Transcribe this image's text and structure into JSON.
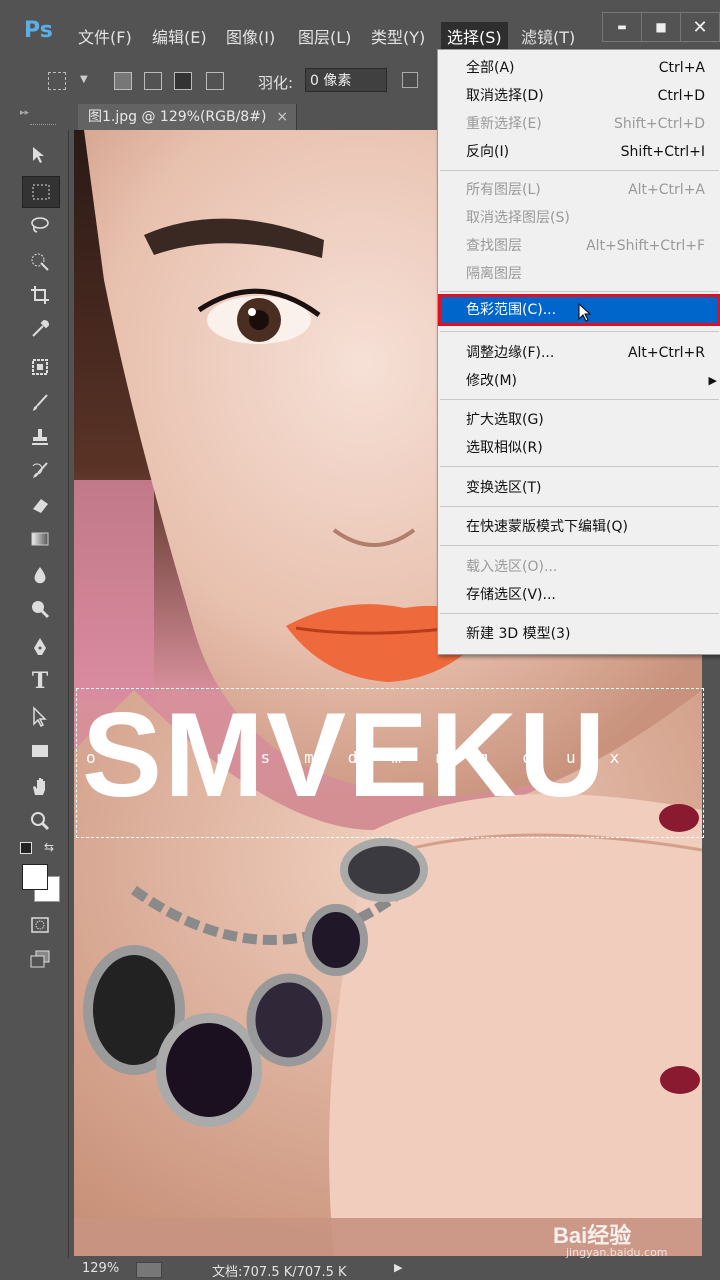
{
  "app": {
    "logo": "Ps"
  },
  "menubar": {
    "items": [
      "文件(F)",
      "编辑(E)",
      "图像(I)",
      "图层(L)",
      "类型(Y)",
      "选择(S)",
      "滤镜(T)"
    ]
  },
  "window_controls": {
    "minimize": "▬",
    "maximize": "■",
    "close": "✕"
  },
  "options": {
    "feather_label": "羽化:",
    "feather_value": "0 像素"
  },
  "document": {
    "tab_title": "图1.jpg @ 129%(RGB/8#)",
    "close": "×"
  },
  "artwork": {
    "brand_text": "SMVEKU",
    "sub_text": "otimsmdmnqoux",
    "watermark": "Bai经验",
    "watermark_url": "jingyan.baidu.com"
  },
  "status": {
    "zoom": "129%",
    "doc_info": "文档:707.5 K/707.5 K"
  },
  "select_menu": {
    "items": [
      {
        "label": "全部(A)",
        "shortcut": "Ctrl+A"
      },
      {
        "label": "取消选择(D)",
        "shortcut": "Ctrl+D"
      },
      {
        "label": "重新选择(E)",
        "shortcut": "Shift+Ctrl+D"
      },
      {
        "label": "反向(I)",
        "shortcut": "Shift+Ctrl+I"
      },
      {
        "label": "所有图层(L)",
        "shortcut": "Alt+Ctrl+A"
      },
      {
        "label": "取消选择图层(S)",
        "shortcut": ""
      },
      {
        "label": "查找图层",
        "shortcut": "Alt+Shift+Ctrl+F"
      },
      {
        "label": "隔离图层",
        "shortcut": ""
      },
      {
        "label": "色彩范围(C)...",
        "shortcut": ""
      },
      {
        "label": "调整边缘(F)...",
        "shortcut": "Alt+Ctrl+R"
      },
      {
        "label": "修改(M)",
        "shortcut": ""
      },
      {
        "label": "扩大选取(G)",
        "shortcut": ""
      },
      {
        "label": "选取相似(R)",
        "shortcut": ""
      },
      {
        "label": "变换选区(T)",
        "shortcut": ""
      },
      {
        "label": "在快速蒙版模式下编辑(Q)",
        "shortcut": ""
      },
      {
        "label": "载入选区(O)...",
        "shortcut": ""
      },
      {
        "label": "存储选区(V)...",
        "shortcut": ""
      },
      {
        "label": "新建 3D 模型(3)",
        "shortcut": ""
      }
    ]
  },
  "colors": {
    "menu_highlight": "#0066cc",
    "highlight_border": "#e01020",
    "ui_gray": "#535353"
  }
}
